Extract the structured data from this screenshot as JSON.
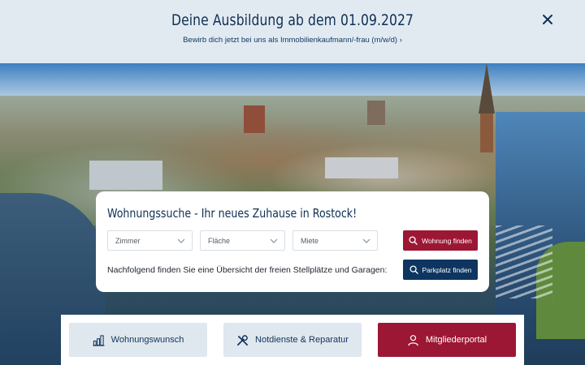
{
  "banner": {
    "title": "Deine Ausbildung ab dem 01.09.2027",
    "link": "Bewirb dich jetzt bei uns als Immobilienkaufmann/-frau (m/w/d) ›"
  },
  "search": {
    "title": "Wohnungssuche - Ihr neues Zuhause in Rostock!",
    "filters": [
      {
        "label": "Zimmer"
      },
      {
        "label": "Fläche"
      },
      {
        "label": "Miete"
      }
    ],
    "find_apartment_label": "Wohnung finden",
    "parking_text": "Nachfolgend finden Sie eine Übersicht der freien Stellplätze und Garagen:",
    "find_parking_label": "Parkplatz finden"
  },
  "tiles": [
    {
      "label": "Wohnungswunsch",
      "icon": "building-chart-icon"
    },
    {
      "label": "Notdienste & Reparatur",
      "icon": "tools-icon"
    },
    {
      "label": "Mitgliederportal",
      "icon": "user-icon"
    }
  ],
  "colors": {
    "navy": "#0d3560",
    "brand_red": "#9c1733",
    "banner_bg": "#e2eaf1",
    "tile_bg": "#dfe7ef"
  }
}
